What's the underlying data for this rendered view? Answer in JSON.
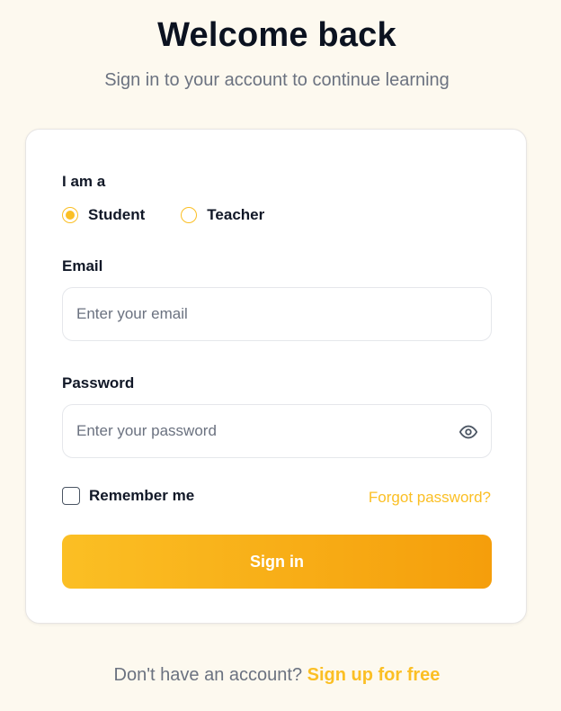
{
  "header": {
    "title": "Welcome back",
    "subtitle": "Sign in to your account to continue learning"
  },
  "form": {
    "role": {
      "label": "I am a",
      "options": [
        {
          "label": "Student",
          "selected": true
        },
        {
          "label": "Teacher",
          "selected": false
        }
      ]
    },
    "email": {
      "label": "Email",
      "value": "",
      "placeholder": "Enter your email"
    },
    "password": {
      "label": "Password",
      "value": "",
      "placeholder": "Enter your password",
      "toggle_icon": "eye-icon"
    },
    "remember": {
      "label": "Remember me",
      "checked": false
    },
    "forgot_link": "Forgot password?",
    "submit_label": "Sign in"
  },
  "footer": {
    "prompt": "Don't have an account?",
    "signup_link": "Sign up for free"
  },
  "colors": {
    "accent": "#fbbf24",
    "accent_dark": "#f59e0b",
    "background": "#fdf9ef",
    "card": "#ffffff",
    "muted_text": "#6b7280",
    "heading": "#0b1220"
  }
}
